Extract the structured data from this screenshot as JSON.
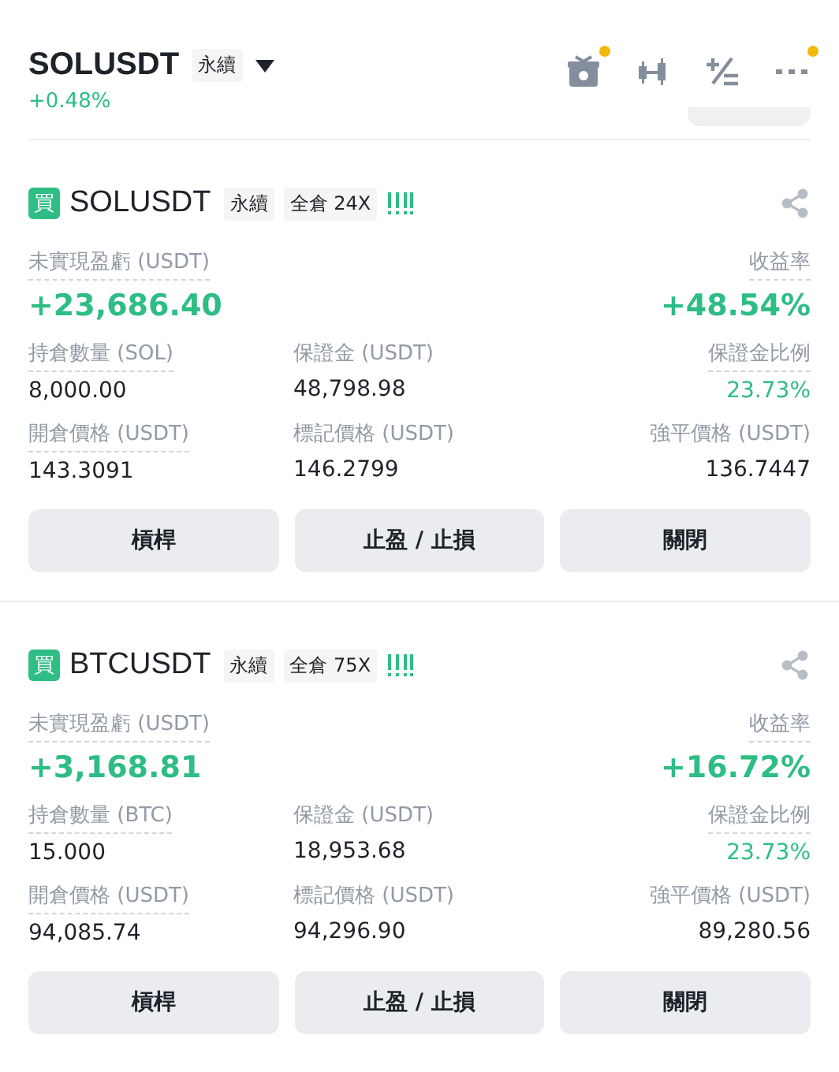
{
  "header": {
    "symbol": "SOLUSDT",
    "tag": "永續",
    "change": "+0.48%",
    "icons": [
      {
        "kind": "gift",
        "dot": true
      },
      {
        "kind": "candles",
        "dot": false
      },
      {
        "kind": "calc",
        "dot": false
      },
      {
        "kind": "more",
        "dot": true
      }
    ]
  },
  "positions": [
    {
      "side": "買",
      "symbol": "SOLUSDT",
      "tags": [
        "永續",
        "全倉 24X"
      ],
      "pnl_label": "未實現盈虧 (USDT)",
      "pnl": "+23,686.40",
      "roe_label": "收益率",
      "roe": "+48.54%",
      "fields": [
        {
          "label": "持倉數量 (SOL)",
          "value": "8,000.00",
          "dotted": true,
          "positive": false
        },
        {
          "label": "保證金 (USDT)",
          "value": "48,798.98",
          "dotted": false,
          "positive": false
        },
        {
          "label": "保證金比例",
          "value": "23.73%",
          "dotted": true,
          "positive": true
        },
        {
          "label": "開倉價格 (USDT)",
          "value": "143.3091",
          "dotted": true,
          "positive": false
        },
        {
          "label": "標記價格 (USDT)",
          "value": "146.2799",
          "dotted": false,
          "positive": false
        },
        {
          "label": "強平價格 (USDT)",
          "value": "136.7447",
          "dotted": false,
          "positive": false
        }
      ],
      "buttons": [
        "槓桿",
        "止盈 / 止損",
        "關閉"
      ]
    },
    {
      "side": "買",
      "symbol": "BTCUSDT",
      "tags": [
        "永續",
        "全倉 75X"
      ],
      "pnl_label": "未實現盈虧 (USDT)",
      "pnl": "+3,168.81",
      "roe_label": "收益率",
      "roe": "+16.72%",
      "fields": [
        {
          "label": "持倉數量 (BTC)",
          "value": "15.000",
          "dotted": true,
          "positive": false
        },
        {
          "label": "保證金 (USDT)",
          "value": "18,953.68",
          "dotted": false,
          "positive": false
        },
        {
          "label": "保證金比例",
          "value": "23.73%",
          "dotted": true,
          "positive": true
        },
        {
          "label": "開倉價格 (USDT)",
          "value": "94,085.74",
          "dotted": true,
          "positive": false
        },
        {
          "label": "標記價格 (USDT)",
          "value": "94,296.90",
          "dotted": false,
          "positive": false
        },
        {
          "label": "強平價格 (USDT)",
          "value": "89,280.56",
          "dotted": false,
          "positive": false
        }
      ],
      "buttons": [
        "槓桿",
        "止盈 / 止損",
        "關閉"
      ]
    }
  ]
}
